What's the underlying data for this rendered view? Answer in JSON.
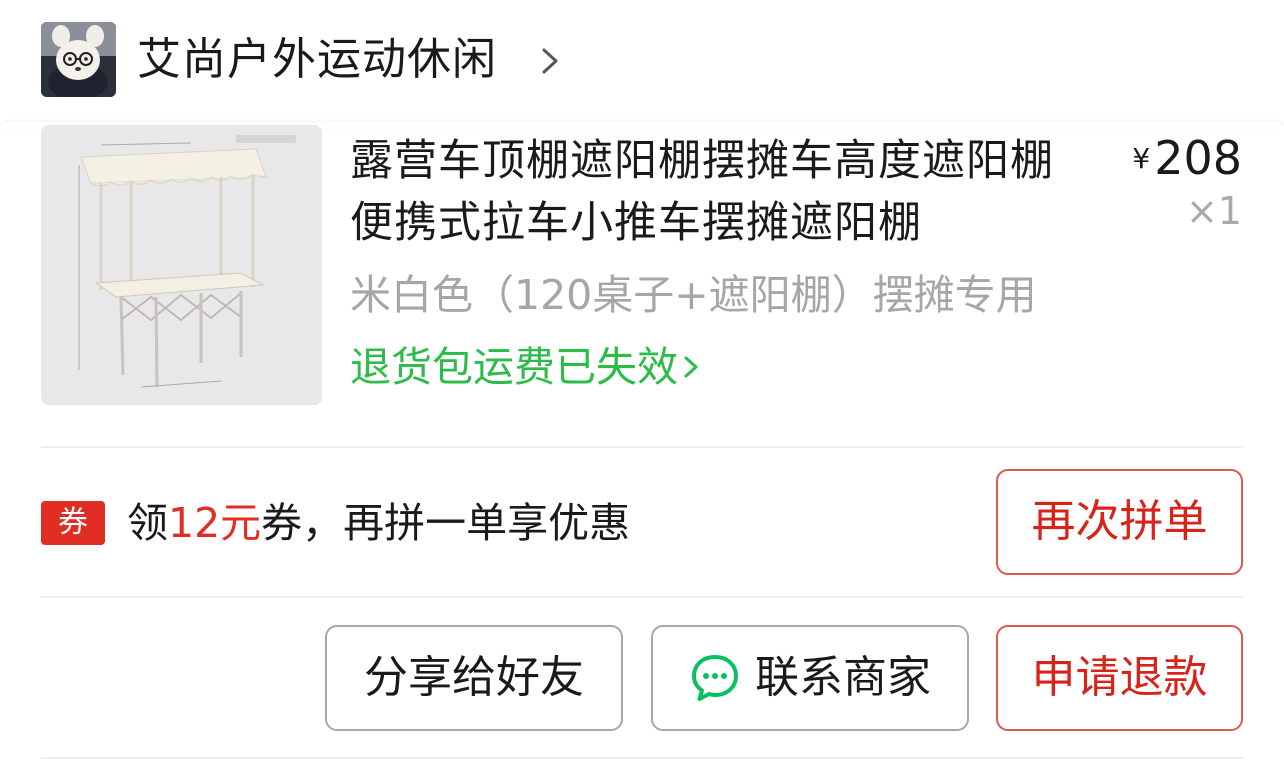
{
  "shop": {
    "name": "艾尚户外运动休闲",
    "avatar_icon": "bear-with-glasses-avatar",
    "chevron_icon": "chevron-right-icon"
  },
  "product": {
    "title": "露营车顶棚遮阳棚摆摊车高度遮阳棚便携式拉车小推车摆摊遮阳棚",
    "price_symbol": "¥",
    "price": "208",
    "quantity": "×1",
    "spec": "米白色（120桌子+遮阳棚）摆摊专用",
    "refund_shipping": "退货包运费已失效",
    "image_icon": "canopy-stall-table-image"
  },
  "coupon": {
    "badge": "券",
    "prefix": "领",
    "amount": "12元",
    "suffix": "券，再拼一单享优惠"
  },
  "actions": {
    "regroup": "再次拼单",
    "share": "分享给好友",
    "contact": "联系商家",
    "refund": "申请退款"
  },
  "colors": {
    "accent_red": "#e02e24",
    "link_green": "#2dbb4a",
    "wechat_green": "#07c160",
    "muted_gray": "#a6a6a6"
  }
}
